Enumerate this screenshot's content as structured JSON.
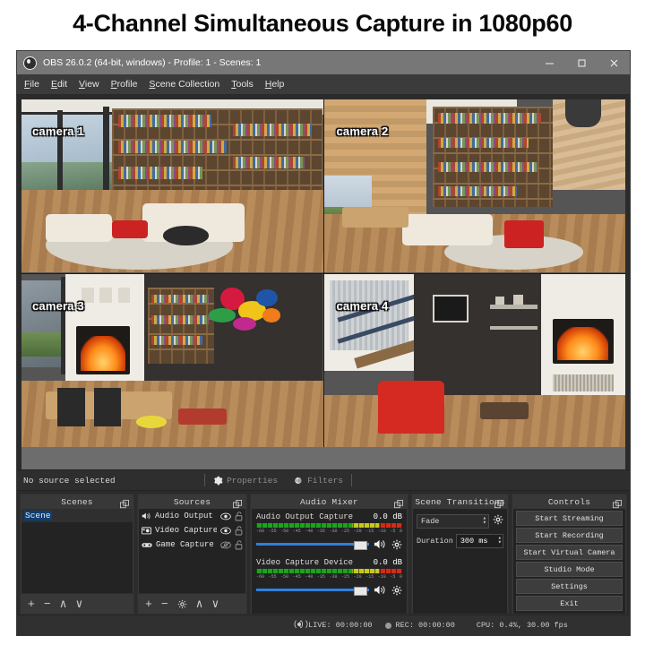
{
  "headline": "4-Channel Simultaneous Capture in 1080p60",
  "window": {
    "title": "OBS 26.0.2 (64-bit, windows) - Profile: 1 - Scenes: 1",
    "logo_icon": "obs-logo-icon",
    "controls": {
      "minimize": "minimize-icon",
      "maximize": "maximize-icon",
      "close": "close-icon"
    }
  },
  "menubar": {
    "items": [
      {
        "label": "File",
        "mnemonic": "F"
      },
      {
        "label": "Edit",
        "mnemonic": "E"
      },
      {
        "label": "View",
        "mnemonic": "V"
      },
      {
        "label": "Profile",
        "mnemonic": "P"
      },
      {
        "label": "Scene Collection",
        "mnemonic": "S"
      },
      {
        "label": "Tools",
        "mnemonic": "T"
      },
      {
        "label": "Help",
        "mnemonic": "H"
      }
    ]
  },
  "preview": {
    "cameras": [
      {
        "label": "camera 1"
      },
      {
        "label": "camera 2"
      },
      {
        "label": "camera 3"
      },
      {
        "label": "camera 4"
      }
    ]
  },
  "source_bar": {
    "status": "No source selected",
    "properties_label": "Properties",
    "properties_icon": "gear-icon",
    "filters_label": "Filters",
    "filters_icon": "filters-icon"
  },
  "scenes": {
    "title": "Scenes",
    "float_icon": "undock-icon",
    "items": [
      {
        "name": "Scene",
        "selected": true
      }
    ],
    "toolbar": [
      {
        "icon": "plus-icon",
        "label": "+"
      },
      {
        "icon": "minus-icon",
        "label": "−"
      },
      {
        "icon": "chevron-up-icon",
        "label": "∧"
      },
      {
        "icon": "chevron-down-icon",
        "label": "∨"
      }
    ]
  },
  "sources": {
    "title": "Sources",
    "float_icon": "undock-icon",
    "items": [
      {
        "name": "Audio Output C",
        "type_icon": "speaker-icon",
        "visible": true,
        "locked": false
      },
      {
        "name": "Video Capture I",
        "type_icon": "camera-icon",
        "visible": true,
        "locked": false
      },
      {
        "name": "Game Capture",
        "type_icon": "gamepad-icon",
        "visible": false,
        "locked": false
      }
    ],
    "toolbar": [
      {
        "icon": "plus-icon",
        "label": "+"
      },
      {
        "icon": "minus-icon",
        "label": "−"
      },
      {
        "icon": "gear-icon",
        "label": "⚙"
      },
      {
        "icon": "chevron-up-icon",
        "label": "∧"
      },
      {
        "icon": "chevron-down-icon",
        "label": "∨"
      }
    ]
  },
  "audio_mixer": {
    "title": "Audio Mixer",
    "float_icon": "undock-icon",
    "scale_ticks": [
      "-60",
      "-55",
      "-50",
      "-45",
      "-40",
      "-35",
      "-30",
      "-25",
      "-20",
      "-15",
      "-10",
      "-5",
      "0"
    ],
    "channels": [
      {
        "name": "Audio Output Capture",
        "db": "0.0 dB",
        "volume_percent": 100,
        "mute_icon": "speaker-icon",
        "settings_icon": "gear-icon"
      },
      {
        "name": "Video Capture Device",
        "db": "0.0 dB",
        "volume_percent": 100,
        "mute_icon": "speaker-icon",
        "settings_icon": "gear-icon"
      }
    ]
  },
  "scene_transitions": {
    "title": "Scene Transitions",
    "float_icon": "undock-icon",
    "transition": "Fade",
    "transition_settings_icon": "gear-icon",
    "duration_label": "Duration",
    "duration_value": "300 ms"
  },
  "controls": {
    "title": "Controls",
    "float_icon": "undock-icon",
    "buttons": [
      {
        "label": "Start Streaming"
      },
      {
        "label": "Start Recording"
      },
      {
        "label": "Start Virtual Camera"
      },
      {
        "label": "Studio Mode"
      },
      {
        "label": "Settings"
      },
      {
        "label": "Exit"
      }
    ]
  },
  "status_bar": {
    "live_icon": "broadcast-icon",
    "live_label": "LIVE: 00:00:00",
    "rec_icon": "record-dot-icon",
    "rec_label": "REC: 00:00:00",
    "cpu_label": "CPU: 0.4%, 30.00 fps"
  },
  "colors": {
    "headline_text": "#0a0a0a",
    "titlebar": "#777777",
    "menubar": "#3b3b3b",
    "window_bg": "#2b2b2b",
    "dock_bg": "#383838",
    "panel_bg": "#232323",
    "accent_blue": "#2f7fe0",
    "selection_blue": "#0d3f73",
    "meter_green": "#1ea21e",
    "meter_yellow": "#c8c81e",
    "meter_red": "#d42b16",
    "letterbox_gray": "#6d6d6d"
  }
}
